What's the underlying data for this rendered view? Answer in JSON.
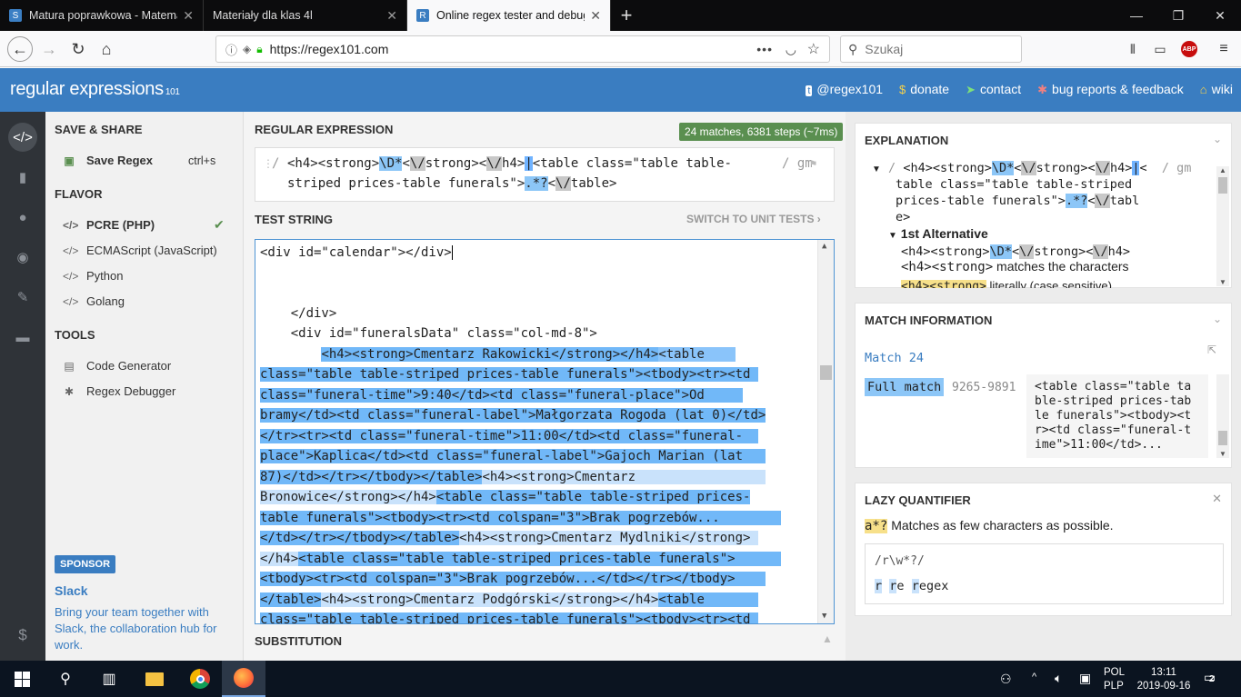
{
  "browser": {
    "tabs": [
      {
        "label": "Matura poprawkowa - Matema",
        "favicon": "S",
        "active": false
      },
      {
        "label": "Materiały dla klas 4l",
        "favicon": "",
        "active": false
      },
      {
        "label": "Online regex tester and debugg",
        "favicon": "R",
        "active": true
      }
    ],
    "url": "https://regex101.com",
    "search_placeholder": "Szukaj",
    "url_menu": "•••"
  },
  "site": {
    "logo_main": "regular expressions",
    "logo_ver": "101",
    "links": [
      {
        "label": "@regex101",
        "icon": "twitter-icon"
      },
      {
        "label": "donate",
        "icon": "dollar-icon"
      },
      {
        "label": "contact",
        "icon": "paper-plane-icon"
      },
      {
        "label": "bug reports & feedback",
        "icon": "bug-icon"
      },
      {
        "label": "wiki",
        "icon": "bank-icon"
      }
    ]
  },
  "sidebar": {
    "save_share": "SAVE & SHARE",
    "save_regex": "Save Regex",
    "save_shortcut": "ctrl+s",
    "flavor": "FLAVOR",
    "flavors": [
      "PCRE (PHP)",
      "ECMAScript (JavaScript)",
      "Python",
      "Golang"
    ],
    "tools": "TOOLS",
    "tool_items": [
      "Code Generator",
      "Regex Debugger"
    ],
    "sponsor_badge": "SPONSOR",
    "sponsor_name": "Slack",
    "sponsor_text": "Bring your team together with Slack, the collaboration hub for work."
  },
  "main": {
    "regex_heading": "REGULAR EXPRESSION",
    "match_badge": "24 matches, 6381 steps (~7ms)",
    "regex_delim": "/",
    "regex_flags": "/ gm",
    "test_heading": "TEST STRING",
    "unit_tests": "SWITCH TO UNIT TESTS",
    "substitution": "SUBSTITUTION"
  },
  "right": {
    "explanation_heading": "EXPLANATION",
    "expl_line2": "table class=\"table table-striped",
    "expl_line3b": "\\/",
    "expl_line3c": "tabl",
    "expl_line4": "e>",
    "alt1": "1st Alternative",
    "alt1_line_a": "<h4><strong>",
    "alt1_line_b": "\\D*",
    "alt1_line_c": "<",
    "alt1_line_d": "\\/",
    "alt1_line_e": "strong><",
    "alt1_line_f": "\\/",
    "alt1_line_g": "h4>",
    "alt1_desc_code": "<h4><strong>",
    "alt1_desc": "matches the characters",
    "alt1_cut": "literally (case sensitive)",
    "match_info_heading": "MATCH INFORMATION",
    "match_label": "Match 24",
    "full_match": "Full match",
    "full_range": "9265-9891",
    "full_value": "<table class=\"table ta ble-striped prices-tab le funerals\"><tbody><t r><td class=\"funeral-t ime\">11:00</td>...",
    "lazy_heading": "LAZY QUANTIFIER",
    "lazy_token": "a*?",
    "lazy_desc": "Matches as few characters as possible.",
    "lazy_example": "/r\\w*?/",
    "lazy_w1": "r",
    "lazy_w2a": "r",
    "lazy_w2b": "e",
    "lazy_w3a": "r",
    "lazy_w3b": "egex"
  },
  "taskbar": {
    "lang1": "POL",
    "lang2": "PLP",
    "time": "13:11",
    "date": "2019-09-16",
    "notif": "2"
  }
}
